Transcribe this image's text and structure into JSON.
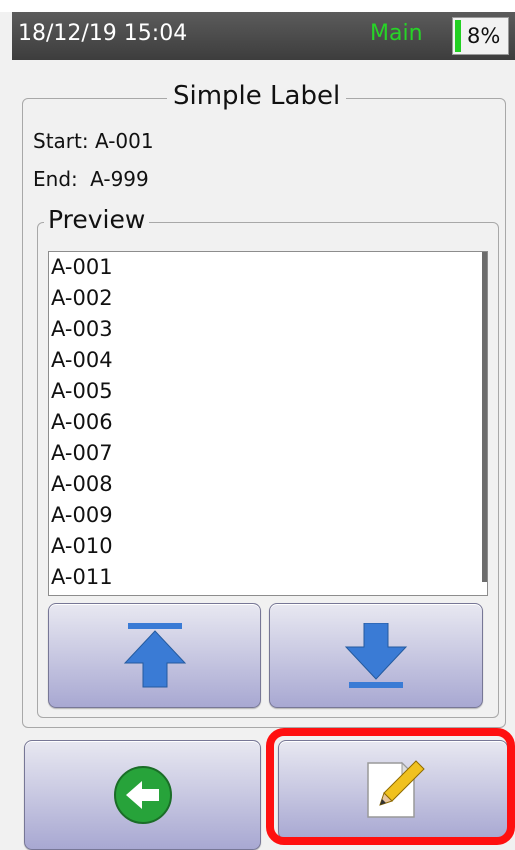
{
  "status_bar": {
    "datetime": "18/12/19 15:04",
    "mode": "Main",
    "battery_percent": "8%",
    "battery_level": 0.08,
    "mode_color": "#27d427"
  },
  "panel": {
    "title": "Simple Label",
    "start_label": "Start:",
    "start_value": "A-001",
    "end_label": "End:",
    "end_value": "A-999"
  },
  "preview": {
    "title": "Preview",
    "items": [
      "A-001",
      "A-002",
      "A-003",
      "A-004",
      "A-005",
      "A-006",
      "A-007",
      "A-008",
      "A-009",
      "A-010",
      "A-011"
    ]
  },
  "buttons": {
    "scroll_top": "arrow-up-to-top-icon",
    "scroll_bottom": "arrow-down-to-bottom-icon",
    "back": "back-arrow-icon",
    "edit": "pencil-paper-icon"
  },
  "colors": {
    "button_gradient_top": "#e8e8f1",
    "button_gradient_bottom": "#a8a8d2",
    "highlight": "#ff1010",
    "arrow_blue": "#3a7bd5",
    "back_green": "#27a33a"
  }
}
